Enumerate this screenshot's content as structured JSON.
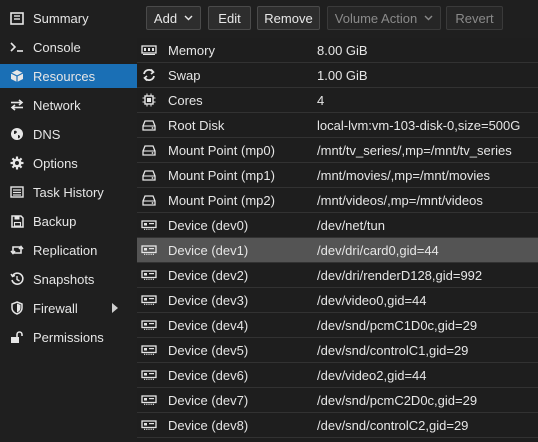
{
  "sidebar": {
    "items": [
      {
        "label": "Summary",
        "icon": "book-icon",
        "active": false
      },
      {
        "label": "Console",
        "icon": "terminal-icon",
        "active": false
      },
      {
        "label": "Resources",
        "icon": "cube-icon",
        "active": true
      },
      {
        "label": "Network",
        "icon": "exchange-icon",
        "active": false
      },
      {
        "label": "DNS",
        "icon": "globe-icon",
        "active": false
      },
      {
        "label": "Options",
        "icon": "gear-icon",
        "active": false
      },
      {
        "label": "Task History",
        "icon": "list-icon",
        "active": false
      },
      {
        "label": "Backup",
        "icon": "floppy-disk-icon",
        "active": false
      },
      {
        "label": "Replication",
        "icon": "retweet-icon",
        "active": false
      },
      {
        "label": "Snapshots",
        "icon": "history-icon",
        "active": false
      },
      {
        "label": "Firewall",
        "icon": "shield-icon",
        "active": false,
        "has_submenu": true
      },
      {
        "label": "Permissions",
        "icon": "unlock-icon",
        "active": false
      }
    ]
  },
  "toolbar": {
    "add_label": "Add",
    "edit_label": "Edit",
    "remove_label": "Remove",
    "volume_action_label": "Volume Action",
    "revert_label": "Revert"
  },
  "resources": {
    "rows": [
      {
        "key": "Memory",
        "value": "8.00 GiB",
        "icon": "memory-icon",
        "selected": false
      },
      {
        "key": "Swap",
        "value": "1.00 GiB",
        "icon": "refresh-icon",
        "selected": false
      },
      {
        "key": "Cores",
        "value": "4",
        "icon": "cpu-icon",
        "selected": false
      },
      {
        "key": "Root Disk",
        "value": "local-lvm:vm-103-disk-0,size=500G",
        "icon": "hdd-icon",
        "selected": false
      },
      {
        "key": "Mount Point (mp0)",
        "value": "/mnt/tv_series/,mp=/mnt/tv_series",
        "icon": "hdd-icon",
        "selected": false
      },
      {
        "key": "Mount Point (mp1)",
        "value": "/mnt/movies/,mp=/mnt/movies",
        "icon": "hdd-icon",
        "selected": false
      },
      {
        "key": "Mount Point (mp2)",
        "value": "/mnt/videos/,mp=/mnt/videos",
        "icon": "hdd-icon",
        "selected": false
      },
      {
        "key": "Device (dev0)",
        "value": "/dev/net/tun",
        "icon": "device-card-icon",
        "selected": false
      },
      {
        "key": "Device (dev1)",
        "value": "/dev/dri/card0,gid=44",
        "icon": "device-card-icon",
        "selected": true
      },
      {
        "key": "Device (dev2)",
        "value": "/dev/dri/renderD128,gid=992",
        "icon": "device-card-icon",
        "selected": false
      },
      {
        "key": "Device (dev3)",
        "value": "/dev/video0,gid=44",
        "icon": "device-card-icon",
        "selected": false
      },
      {
        "key": "Device (dev4)",
        "value": "/dev/snd/pcmC1D0c,gid=29",
        "icon": "device-card-icon",
        "selected": false
      },
      {
        "key": "Device (dev5)",
        "value": "/dev/snd/controlC1,gid=29",
        "icon": "device-card-icon",
        "selected": false
      },
      {
        "key": "Device (dev6)",
        "value": "/dev/video2,gid=44",
        "icon": "device-card-icon",
        "selected": false
      },
      {
        "key": "Device (dev7)",
        "value": "/dev/snd/pcmC2D0c,gid=29",
        "icon": "device-card-icon",
        "selected": false
      },
      {
        "key": "Device (dev8)",
        "value": "/dev/snd/controlC2,gid=29",
        "icon": "device-card-icon",
        "selected": false
      }
    ]
  },
  "colors": {
    "accent": "#1a6fb5",
    "selected_row": "#545454",
    "background": "#1e1e1e"
  }
}
